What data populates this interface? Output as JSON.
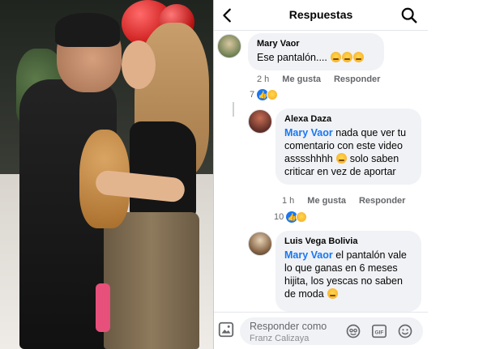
{
  "header": {
    "title": "Respuestas"
  },
  "comments": [
    {
      "author": "Mary Vaor",
      "text": "Ese pantalón....",
      "emoji_count": 3,
      "time": "2 h",
      "like_label": "Me gusta",
      "reply_label": "Responder",
      "reaction_count": "7"
    },
    {
      "author": "Alexa Daza",
      "mention": "Mary Vaor",
      "text": " nada que ver tu comentario con este video asssshhhh",
      "text2": " solo saben criticar en vez de aportar",
      "time": "1 h",
      "like_label": "Me gusta",
      "reply_label": "Responder",
      "reaction_count": "10"
    },
    {
      "author": "Luis Vega Bolivia",
      "mention": "Mary Vaor",
      "text": " el pantalón vale lo que ganas en 6 meses hijita, los yescas no saben de moda"
    }
  ],
  "composer": {
    "placeholder": "Responder como",
    "placeholder_name": "Franz Calizaya"
  },
  "icons": {
    "back": "back-arrow-icon",
    "search": "search-icon",
    "photo": "photo-icon",
    "avatar_sticker": "avatar-sticker-icon",
    "gif": "gif-icon",
    "emoji": "emoji-icon"
  },
  "colors": {
    "accent": "#1877f2",
    "bubble": "#f0f2f5",
    "meta_text": "#65676b"
  }
}
